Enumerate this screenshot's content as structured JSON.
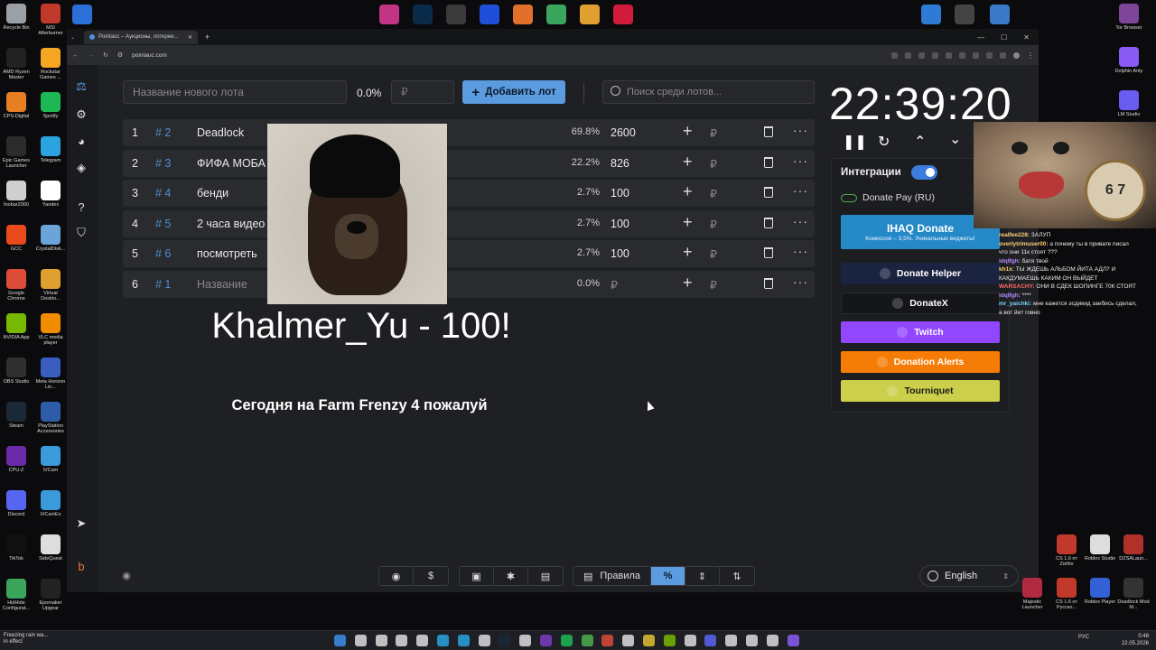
{
  "desktop": {
    "left_icons": [
      {
        "label": "Recycle Bin",
        "color": "#9aa0a6"
      },
      {
        "label": "MSI Afterburner",
        "color": "#c0392b"
      },
      {
        "label": "AMD Ryzen Master",
        "color": "#222222"
      },
      {
        "label": "Rockstar Games ...",
        "color": "#f5a623"
      },
      {
        "label": "CPS-Digital",
        "color": "#e67e22"
      },
      {
        "label": "Spotify",
        "color": "#1db954"
      },
      {
        "label": "Epic Games Launcher",
        "color": "#2c2c2c"
      },
      {
        "label": "Telegram",
        "color": "#2aa3df"
      },
      {
        "label": "foobar2000",
        "color": "#cfcfcf"
      },
      {
        "label": "Yandex",
        "color": "#ffffff"
      },
      {
        "label": "GCC",
        "color": "#e84a1c"
      },
      {
        "label": "CrystalDisk...",
        "color": "#6aa4d8"
      },
      {
        "label": "Google Chrome",
        "color": "#dd4b39"
      },
      {
        "label": "Virtual Deskto...",
        "color": "#e0a030"
      },
      {
        "label": "NVIDIA App",
        "color": "#76b900"
      },
      {
        "label": "VLC media player",
        "color": "#f18b00"
      },
      {
        "label": "OBS Studio",
        "color": "#303030"
      },
      {
        "label": "Meta Horizon Lin...",
        "color": "#3a5ec0"
      },
      {
        "label": "Steam",
        "color": "#1b2838"
      },
      {
        "label": "PlayStation Accessories",
        "color": "#2e5ca8"
      },
      {
        "label": "CPU-Z",
        "color": "#6b2aa8"
      },
      {
        "label": "iVCam",
        "color": "#3b9ad9"
      },
      {
        "label": "Discord",
        "color": "#5865f2"
      },
      {
        "label": "iVCamEx",
        "color": "#3b9ad9"
      },
      {
        "label": "TikTok",
        "color": "#111111"
      },
      {
        "label": "SideQuest",
        "color": "#dddddd"
      },
      {
        "label": "HidHide Configurat...",
        "color": "#3ba55c"
      },
      {
        "label": "Epomaker Upgear",
        "color": "#222222"
      }
    ],
    "right_icons": [
      {
        "label": "Tor Browser",
        "color": "#7d4698"
      },
      {
        "label": "Dolphin Anty",
        "color": "#8a5cf5"
      },
      {
        "label": "LM Studio",
        "color": "#6a5cf0"
      }
    ],
    "bottom_right_icons": [
      {
        "label": "CS 1.6 от Zetihs",
        "color": "#c0392b"
      },
      {
        "label": "Roblox Studio",
        "color": "#dddddd"
      },
      {
        "label": "DZSALaun...",
        "color": "#b0302a"
      },
      {
        "label": "Majestic Launcher",
        "color": "#b02a40"
      },
      {
        "label": "CS 1.6 от Русско...",
        "color": "#c0392b"
      },
      {
        "label": "Roblox Player",
        "color": "#3360d6"
      },
      {
        "label": "Deadlock Mod M...",
        "color": "#333333"
      }
    ]
  },
  "browser": {
    "tab_title": "Pointauc – Аукционы, лотереи...",
    "url": "pointauc.com"
  },
  "controls": {
    "new_lot_placeholder": "Название нового лота",
    "percent": "0.0%",
    "amount_placeholder": "₽",
    "add_lot_label": "Добавить лот",
    "search_placeholder": "Поиск среди лотов..."
  },
  "lots": [
    {
      "num": "1",
      "hash": "# 2",
      "name": "Deadlock",
      "pct": "69.8%",
      "value": "2600",
      "currency": "₽"
    },
    {
      "num": "2",
      "hash": "# 3",
      "name": "ФИФА МОБА",
      "pct": "22.2%",
      "value": "826",
      "currency": "₽"
    },
    {
      "num": "3",
      "hash": "# 4",
      "name": "бенди",
      "pct": "2.7%",
      "value": "100",
      "currency": "₽"
    },
    {
      "num": "4",
      "hash": "# 5",
      "name": "2 часа видео",
      "pct": "2.7%",
      "value": "100",
      "currency": "₽"
    },
    {
      "num": "5",
      "hash": "# 6",
      "name": "посмотреть",
      "pct": "2.7%",
      "value": "100",
      "currency": "₽"
    },
    {
      "num": "6",
      "hash": "# 1",
      "name": "Название",
      "pct": "0.0%",
      "value": "₽",
      "currency": "₽"
    }
  ],
  "donation": {
    "title": "Khalmer_Yu - 100!",
    "message": "Сегодня на Farm Frenzy 4 пожалуй"
  },
  "timer": {
    "time": "22:39:20"
  },
  "integrations": {
    "title": "Интеграции",
    "donate_pay": "Donate Pay (RU)",
    "ihaq_title": "IHAQ Donate",
    "ihaq_sub": "Комиссия – 3,5%. Уникальные виджеты!",
    "buttons": [
      {
        "label": "Donate Helper",
        "color": "#1a2340"
      },
      {
        "label": "DonateX",
        "color": "#151619"
      },
      {
        "label": "Twitch",
        "color": "#9146ff"
      },
      {
        "label": "Donation Alerts",
        "color": "#f57d07"
      },
      {
        "label": "Tourniquet",
        "color": "#cbcf4a"
      }
    ]
  },
  "cat_overlay": {
    "clock_text": "6 7"
  },
  "chat": [
    {
      "user": "realfee228:",
      "text": "ЗАЛУП",
      "color": "#ffd27a"
    },
    {
      "user": "overlytrimuser00:",
      "text": "а почему ты в привате писал что они 11к стоят ???",
      "color": "#ffd27a"
    },
    {
      "user": "idqlfgh:",
      "text": "батя твой",
      "color": "#b48cff"
    },
    {
      "user": "kh1x:",
      "text": "ТЫ ЖДЕШЬ АЛЬБОМ ЙИТА АДЛ? И КАКДУМАЕШЬ КАКИМ ОН ВЫЙДЕТ",
      "color": "#ffd27a"
    },
    {
      "user": "WARSACHY:",
      "text": "ОНИ В СДЕК ШОПИНГЕ 70К СТОЯТ",
      "color": "#ff6a6a"
    },
    {
      "user": "idqlfgh:",
      "text": "****",
      "color": "#b48cff"
    },
    {
      "user": "mr_yaichki:",
      "text": "мне кажется эсдикид заебись сделал, а вот йит говно",
      "color": "#7ad4ff"
    }
  ],
  "bottom_bar": {
    "rules_label": "Правила",
    "language": "English"
  },
  "taskbar": {
    "weather_line1": "Freezing rain wa...",
    "weather_line2": "in effect",
    "lang": "РУС",
    "time": "0:48",
    "date": "22.05.2026"
  }
}
